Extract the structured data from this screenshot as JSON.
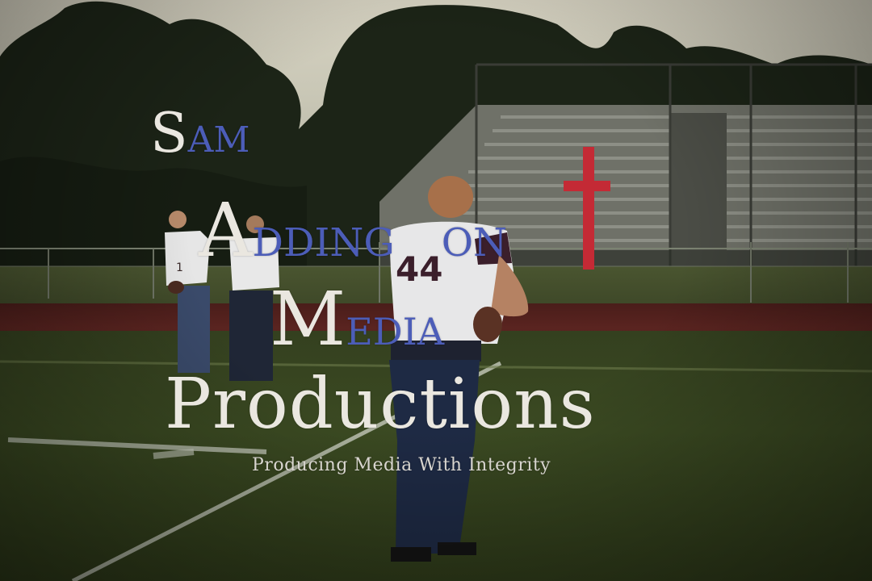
{
  "photo": {
    "subject": "football player",
    "jersey_number": "44"
  },
  "watermark": {
    "line1_cap": "S",
    "line1_rest": "AM",
    "line2_cap": "A",
    "line2_rest_a": "DDING",
    "line2_rest_b": "ON",
    "line3_cap": "M",
    "line3_rest": "EDIA",
    "line4": "Productions",
    "tagline": "Producing Media With Integrity",
    "cross_color": "#c42a35",
    "accent_color": "#4c5db8"
  }
}
